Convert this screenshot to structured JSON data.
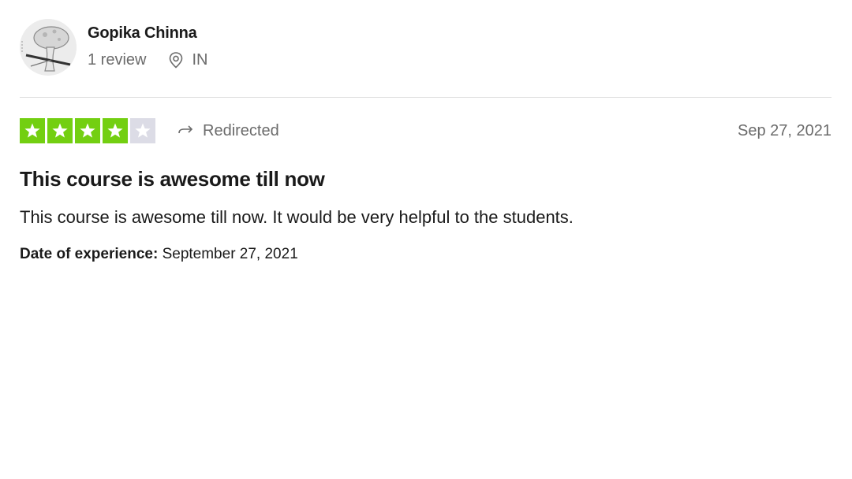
{
  "reviewer": {
    "name": "Gopika Chinna",
    "review_count": "1 review",
    "country": "IN",
    "avatar_icon": "user-avatar-icon",
    "location_icon": "location-pin-icon"
  },
  "review": {
    "rating": 4,
    "rating_max": 5,
    "rating_color": "#73cf11",
    "empty_star_color": "#dcdce6",
    "source_icon": "redirect-arrow-icon",
    "source_label": "Redirected",
    "date": "Sep 27, 2021",
    "title": "This course is awesome till now",
    "body": "This course is awesome till now. It would be very helpful to the students.",
    "experience_label": "Date of experience:",
    "experience_date": "September 27, 2021"
  }
}
